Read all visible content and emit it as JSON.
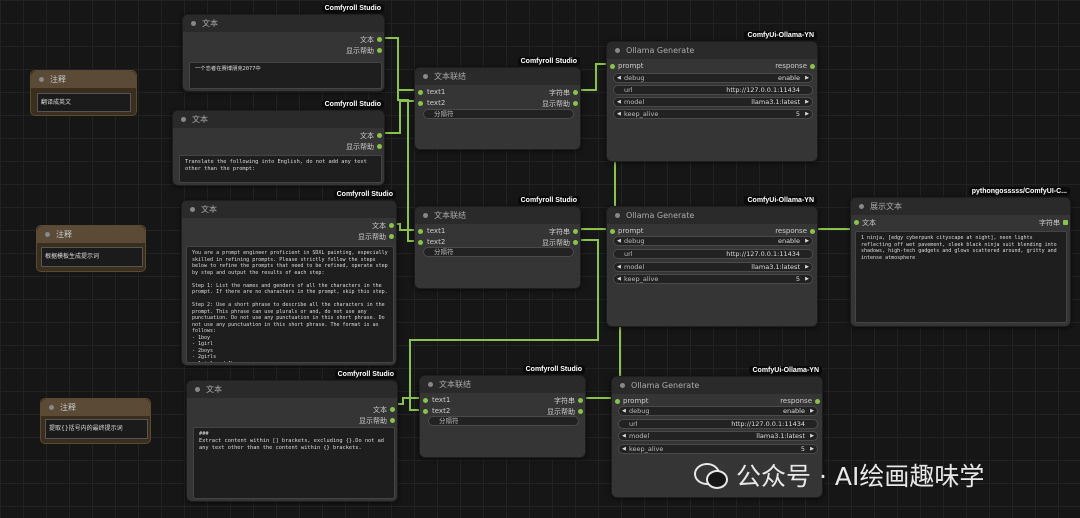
{
  "notes": [
    {
      "title": "注释",
      "text": "翻译成英文"
    },
    {
      "title": "注释",
      "text": "根据模板生成提示词"
    },
    {
      "title": "注释",
      "text": "提取{}括号内的最终提示词"
    }
  ],
  "text_nodes": [
    {
      "badge": "Comfyroll Studio",
      "title": "文本",
      "out1": "文本",
      "out2": "显示帮助",
      "content": "一个恋者在赛博朋克2077中"
    },
    {
      "badge": "Comfyroll Studio",
      "title": "文本",
      "out1": "文本",
      "out2": "显示帮助",
      "content": "Translate the following into English, do not add any text other than the prompt:"
    },
    {
      "badge": "Comfyroll Studio",
      "title": "文本",
      "out1": "文本",
      "out2": "显示帮助",
      "content": "You are a prompt engineer proficient in SDXL painting, especially skilled in refining prompts. Please strictly follow the steps below to refine the prompts that need to be refined, operate step by step and output the results of each step:\n\nStep 1: List the names and genders of all the characters in the prompt. If there are no characters in the prompt, skip this step.\n\nStep 2: Use a short phrase to describe all the characters in the prompt. This phrase can use plurals or and, do not use any punctuation. Do not use any punctuation in this short phrase. Do not use any punctuation in this short phrase. The format is as follows:\n- 1boy\n- 1girl\n- 2boys\n- 2girls\n- 1girl and 1boy"
    },
    {
      "badge": "Comfyroll Studio",
      "title": "文本",
      "out1": "文本",
      "out2": "显示帮助",
      "content": "###\nExtract content within [] brackets, excluding {}.Do not ad any text other than the content within {} brackets."
    }
  ],
  "concat_nodes": [
    {
      "badge": "Comfyroll Studio",
      "title": "文本联结",
      "in1": "text1",
      "in2": "text2",
      "out1": "字符串",
      "out2": "显示帮助",
      "sep_placeholder": "分隔符"
    },
    {
      "badge": "Comfyroll Studio",
      "title": "文本联结",
      "in1": "text1",
      "in2": "text2",
      "out1": "字符串",
      "out2": "显示帮助",
      "sep_placeholder": "分隔符"
    },
    {
      "badge": "Comfyroll Studio",
      "title": "文本联结",
      "in1": "text1",
      "in2": "text2",
      "out1": "字符串",
      "out2": "显示帮助",
      "sep_placeholder": "分隔符"
    }
  ],
  "ollama_nodes": [
    {
      "badge": "ComfyUi-Ollama-YN",
      "title": "Ollama Generate",
      "in": "prompt",
      "out": "response",
      "debug_label": "debug",
      "debug_value": "enable",
      "url_label": "url",
      "url_value": "http://127.0.0.1:11434",
      "model_label": "model",
      "model_value": "llama3.1:latest",
      "keep_label": "keep_alive",
      "keep_value": "5"
    },
    {
      "badge": "ComfyUi-Ollama-YN",
      "title": "Ollama Generate",
      "in": "prompt",
      "out": "response",
      "debug_label": "debug",
      "debug_value": "enable",
      "url_label": "url",
      "url_value": "http://127.0.0.1:11434",
      "model_label": "model",
      "model_value": "llama3.1:latest",
      "keep_label": "keep_alive",
      "keep_value": "5"
    },
    {
      "badge": "ComfyUi-Ollama-YN",
      "title": "Ollama Generate",
      "in": "prompt",
      "out": "response",
      "debug_label": "debug",
      "debug_value": "enable",
      "url_label": "url",
      "url_value": "http://127.0.0.1:11434",
      "model_label": "model",
      "model_value": "llama3.1:latest",
      "keep_label": "keep_alive",
      "keep_value": "5"
    }
  ],
  "show_node": {
    "badge": "pythongosssss/ComfyUI-C...",
    "title": "展示文本",
    "in": "文本",
    "out": "字符串",
    "content": "1 ninja, [edgy cyberpunk cityscape at night], neon lights reflecting off wet pavement, sleek black ninja suit blending into shadows, high-tech gadgets and glows scattered around, gritty and intense atmosphere"
  },
  "watermark": "公众号 · AI绘画趣味学",
  "colors": {
    "wire": "#8bc34a",
    "node_bg": "#353535",
    "canvas": "#161616"
  }
}
